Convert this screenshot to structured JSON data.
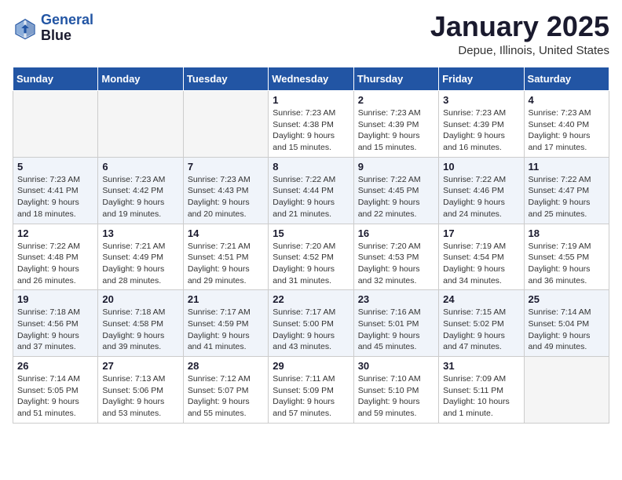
{
  "logo": {
    "line1": "General",
    "line2": "Blue"
  },
  "title": "January 2025",
  "location": "Depue, Illinois, United States",
  "days_of_week": [
    "Sunday",
    "Monday",
    "Tuesday",
    "Wednesday",
    "Thursday",
    "Friday",
    "Saturday"
  ],
  "weeks": [
    {
      "shaded": false,
      "days": [
        {
          "num": "",
          "text": ""
        },
        {
          "num": "",
          "text": ""
        },
        {
          "num": "",
          "text": ""
        },
        {
          "num": "1",
          "text": "Sunrise: 7:23 AM\nSunset: 4:38 PM\nDaylight: 9 hours and 15 minutes."
        },
        {
          "num": "2",
          "text": "Sunrise: 7:23 AM\nSunset: 4:39 PM\nDaylight: 9 hours and 15 minutes."
        },
        {
          "num": "3",
          "text": "Sunrise: 7:23 AM\nSunset: 4:39 PM\nDaylight: 9 hours and 16 minutes."
        },
        {
          "num": "4",
          "text": "Sunrise: 7:23 AM\nSunset: 4:40 PM\nDaylight: 9 hours and 17 minutes."
        }
      ]
    },
    {
      "shaded": true,
      "days": [
        {
          "num": "5",
          "text": "Sunrise: 7:23 AM\nSunset: 4:41 PM\nDaylight: 9 hours and 18 minutes."
        },
        {
          "num": "6",
          "text": "Sunrise: 7:23 AM\nSunset: 4:42 PM\nDaylight: 9 hours and 19 minutes."
        },
        {
          "num": "7",
          "text": "Sunrise: 7:23 AM\nSunset: 4:43 PM\nDaylight: 9 hours and 20 minutes."
        },
        {
          "num": "8",
          "text": "Sunrise: 7:22 AM\nSunset: 4:44 PM\nDaylight: 9 hours and 21 minutes."
        },
        {
          "num": "9",
          "text": "Sunrise: 7:22 AM\nSunset: 4:45 PM\nDaylight: 9 hours and 22 minutes."
        },
        {
          "num": "10",
          "text": "Sunrise: 7:22 AM\nSunset: 4:46 PM\nDaylight: 9 hours and 24 minutes."
        },
        {
          "num": "11",
          "text": "Sunrise: 7:22 AM\nSunset: 4:47 PM\nDaylight: 9 hours and 25 minutes."
        }
      ]
    },
    {
      "shaded": false,
      "days": [
        {
          "num": "12",
          "text": "Sunrise: 7:22 AM\nSunset: 4:48 PM\nDaylight: 9 hours and 26 minutes."
        },
        {
          "num": "13",
          "text": "Sunrise: 7:21 AM\nSunset: 4:49 PM\nDaylight: 9 hours and 28 minutes."
        },
        {
          "num": "14",
          "text": "Sunrise: 7:21 AM\nSunset: 4:51 PM\nDaylight: 9 hours and 29 minutes."
        },
        {
          "num": "15",
          "text": "Sunrise: 7:20 AM\nSunset: 4:52 PM\nDaylight: 9 hours and 31 minutes."
        },
        {
          "num": "16",
          "text": "Sunrise: 7:20 AM\nSunset: 4:53 PM\nDaylight: 9 hours and 32 minutes."
        },
        {
          "num": "17",
          "text": "Sunrise: 7:19 AM\nSunset: 4:54 PM\nDaylight: 9 hours and 34 minutes."
        },
        {
          "num": "18",
          "text": "Sunrise: 7:19 AM\nSunset: 4:55 PM\nDaylight: 9 hours and 36 minutes."
        }
      ]
    },
    {
      "shaded": true,
      "days": [
        {
          "num": "19",
          "text": "Sunrise: 7:18 AM\nSunset: 4:56 PM\nDaylight: 9 hours and 37 minutes."
        },
        {
          "num": "20",
          "text": "Sunrise: 7:18 AM\nSunset: 4:58 PM\nDaylight: 9 hours and 39 minutes."
        },
        {
          "num": "21",
          "text": "Sunrise: 7:17 AM\nSunset: 4:59 PM\nDaylight: 9 hours and 41 minutes."
        },
        {
          "num": "22",
          "text": "Sunrise: 7:17 AM\nSunset: 5:00 PM\nDaylight: 9 hours and 43 minutes."
        },
        {
          "num": "23",
          "text": "Sunrise: 7:16 AM\nSunset: 5:01 PM\nDaylight: 9 hours and 45 minutes."
        },
        {
          "num": "24",
          "text": "Sunrise: 7:15 AM\nSunset: 5:02 PM\nDaylight: 9 hours and 47 minutes."
        },
        {
          "num": "25",
          "text": "Sunrise: 7:14 AM\nSunset: 5:04 PM\nDaylight: 9 hours and 49 minutes."
        }
      ]
    },
    {
      "shaded": false,
      "days": [
        {
          "num": "26",
          "text": "Sunrise: 7:14 AM\nSunset: 5:05 PM\nDaylight: 9 hours and 51 minutes."
        },
        {
          "num": "27",
          "text": "Sunrise: 7:13 AM\nSunset: 5:06 PM\nDaylight: 9 hours and 53 minutes."
        },
        {
          "num": "28",
          "text": "Sunrise: 7:12 AM\nSunset: 5:07 PM\nDaylight: 9 hours and 55 minutes."
        },
        {
          "num": "29",
          "text": "Sunrise: 7:11 AM\nSunset: 5:09 PM\nDaylight: 9 hours and 57 minutes."
        },
        {
          "num": "30",
          "text": "Sunrise: 7:10 AM\nSunset: 5:10 PM\nDaylight: 9 hours and 59 minutes."
        },
        {
          "num": "31",
          "text": "Sunrise: 7:09 AM\nSunset: 5:11 PM\nDaylight: 10 hours and 1 minute."
        },
        {
          "num": "",
          "text": ""
        }
      ]
    }
  ]
}
